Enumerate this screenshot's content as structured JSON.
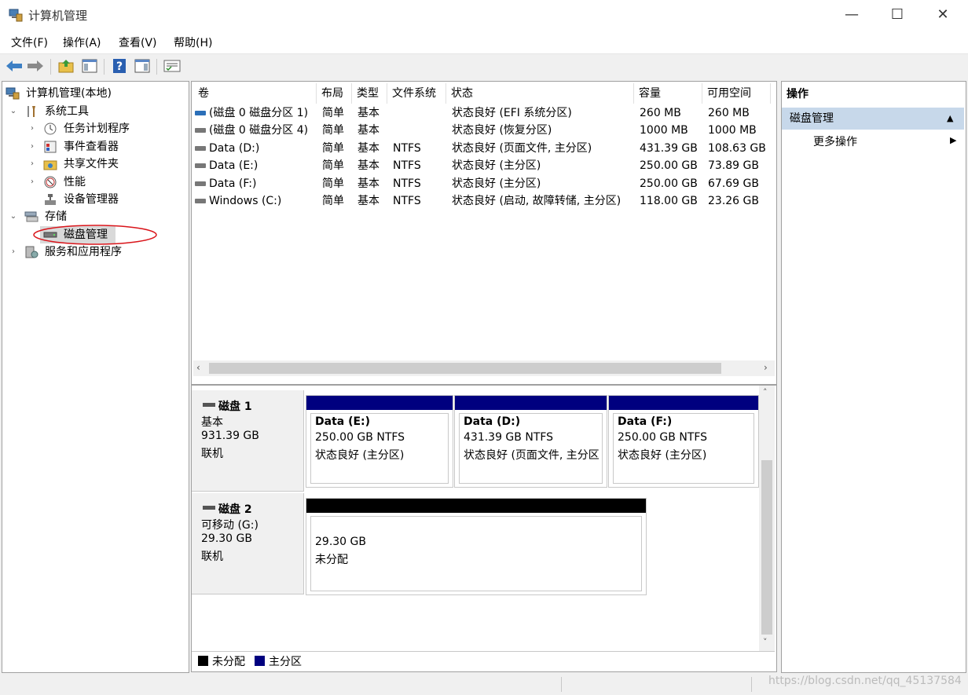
{
  "window": {
    "title": "计算机管理",
    "minimize_glyph": "—",
    "maximize_glyph": "☐",
    "close_glyph": "✕"
  },
  "menu": [
    "文件(F)",
    "操作(A)",
    "查看(V)",
    "帮助(H)"
  ],
  "toolbar": {
    "icons": [
      "back-arrow-icon",
      "forward-arrow-icon",
      "up-folder-icon",
      "show-hide-tree-icon",
      "help-icon",
      "show-action-pane-icon",
      "properties-icon"
    ]
  },
  "tree": {
    "root": "计算机管理(本地)",
    "system_tools": "系统工具",
    "task_scheduler": "任务计划程序",
    "event_viewer": "事件查看器",
    "shared_folders": "共享文件夹",
    "performance": "性能",
    "device_manager": "设备管理器",
    "storage": "存储",
    "disk_management": "磁盘管理",
    "services_apps": "服务和应用程序"
  },
  "volume_table": {
    "headers": [
      "卷",
      "布局",
      "类型",
      "文件系统",
      "状态",
      "容量",
      "可用空间"
    ],
    "rows": [
      {
        "vol": "(磁盘 0 磁盘分区 1)",
        "layout": "简单",
        "type": "基本",
        "fs": "",
        "status": "状态良好 (EFI 系统分区)",
        "capacity": "260 MB",
        "free": "260 MB",
        "icon": "blue"
      },
      {
        "vol": "(磁盘 0 磁盘分区 4)",
        "layout": "简单",
        "type": "基本",
        "fs": "",
        "status": "状态良好 (恢复分区)",
        "capacity": "1000 MB",
        "free": "1000 MB",
        "icon": "gray"
      },
      {
        "vol": "Data (D:)",
        "layout": "简单",
        "type": "基本",
        "fs": "NTFS",
        "status": "状态良好 (页面文件, 主分区)",
        "capacity": "431.39 GB",
        "free": "108.63 GB",
        "icon": "gray"
      },
      {
        "vol": "Data (E:)",
        "layout": "简单",
        "type": "基本",
        "fs": "NTFS",
        "status": "状态良好 (主分区)",
        "capacity": "250.00 GB",
        "free": "73.89 GB",
        "icon": "gray"
      },
      {
        "vol": "Data (F:)",
        "layout": "简单",
        "type": "基本",
        "fs": "NTFS",
        "status": "状态良好 (主分区)",
        "capacity": "250.00 GB",
        "free": "67.69 GB",
        "icon": "gray"
      },
      {
        "vol": "Windows (C:)",
        "layout": "简单",
        "type": "基本",
        "fs": "NTFS",
        "status": "状态良好 (启动, 故障转储, 主分区)",
        "capacity": "118.00 GB",
        "free": "23.26 GB",
        "icon": "gray"
      }
    ]
  },
  "disks": {
    "disk1": {
      "name": "磁盘 1",
      "kind": "基本",
      "size": "931.39 GB",
      "state": "联机",
      "partitions": [
        {
          "name": "Data  (E:)",
          "size": "250.00 GB NTFS",
          "status": "状态良好 (主分区)"
        },
        {
          "name": "Data  (D:)",
          "size": "431.39 GB NTFS",
          "status": "状态良好 (页面文件, 主分区"
        },
        {
          "name": "Data  (F:)",
          "size": "250.00 GB NTFS",
          "status": "状态良好 (主分区)"
        }
      ]
    },
    "disk2": {
      "name": "磁盘 2",
      "kind": "可移动 (G:)",
      "size": "29.30 GB",
      "state": "联机",
      "partition": {
        "size": "29.30 GB",
        "status": "未分配"
      }
    }
  },
  "legend": {
    "unallocated": "未分配",
    "primary": "主分区"
  },
  "actions": {
    "header": "操作",
    "selected": "磁盘管理",
    "more": "更多操作"
  },
  "colors": {
    "primary_partition": "#00007f",
    "unallocated": "#000000",
    "selection_highlight": "#c7d8ea",
    "annotation_ellipse": "#d9141a"
  },
  "watermark": "https://blog.csdn.net/qq_45137584"
}
